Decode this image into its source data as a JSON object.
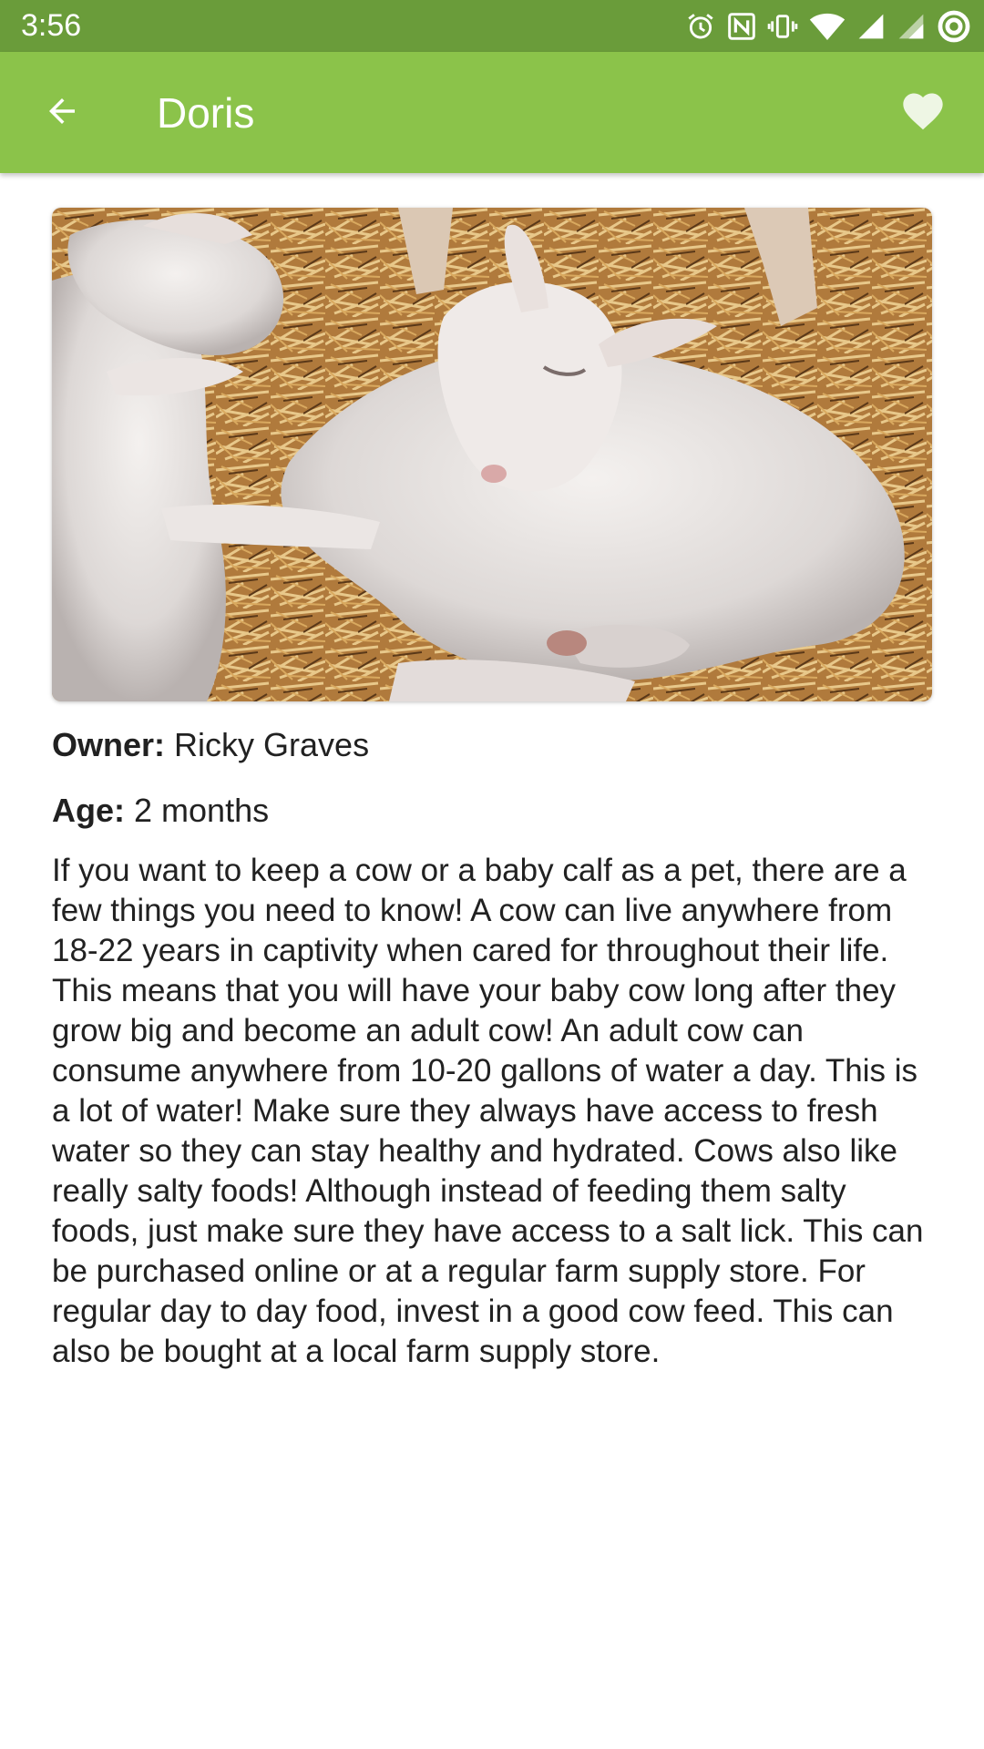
{
  "status_bar": {
    "time": "3:56",
    "icons": [
      "alarm-icon",
      "nfc-icon",
      "vibrate-icon",
      "wifi-icon",
      "signal-icon",
      "signal-icon",
      "sync-icon"
    ]
  },
  "app_bar": {
    "title": "Doris",
    "back_icon": "arrow-back-icon",
    "favorite_icon": "heart-icon"
  },
  "photo": {
    "subject": "baby-animals-sleeping-in-straw"
  },
  "details": {
    "owner_label": "Owner:",
    "owner_value": "Ricky Graves",
    "age_label": "Age:",
    "age_value": "2 months",
    "description": "If you want to keep a cow or a baby calf as a pet, there are a few things you need to know! A cow can live anywhere from 18-22 years in captivity when cared for throughout their life. This means that you will have your baby cow long after they grow big and become an adult cow! An adult cow can consume anywhere from 10-20 gallons of water a day. This is a lot of water! Make sure they always have access to fresh water so they can stay healthy and hydrated. Cows also like really salty foods! Although instead of feeding them salty foods, just make sure they have access to a salt lick. This can be purchased online or at a regular farm supply store. For regular day to day food, invest in a good cow feed. This can also be bought at a local farm supply store."
  },
  "colors": {
    "status_bar": "#6a9c3a",
    "app_bar": "#8bc34a",
    "text": "#212121"
  }
}
